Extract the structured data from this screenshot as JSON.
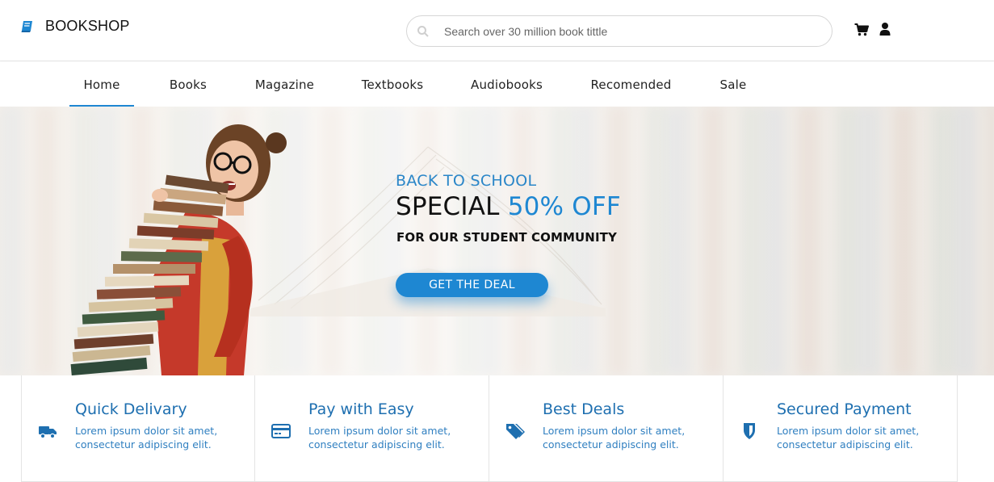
{
  "brand": {
    "name": "BOOKSHOP",
    "icon": "book-icon",
    "accent": "#1e87d2"
  },
  "search": {
    "placeholder": "Search over 30 million book tittle",
    "value": ""
  },
  "header_icons": [
    "cart-icon",
    "user-icon"
  ],
  "nav": {
    "items": [
      {
        "label": "Home",
        "active": true
      },
      {
        "label": "Books",
        "active": false
      },
      {
        "label": "Magazine",
        "active": false
      },
      {
        "label": "Textbooks",
        "active": false
      },
      {
        "label": "Audiobooks",
        "active": false
      },
      {
        "label": "Recomended",
        "active": false
      },
      {
        "label": "Sale",
        "active": false
      }
    ]
  },
  "hero": {
    "kicker": "BACK TO SCHOOL",
    "title_main": "SPECIAL ",
    "title_accent": "50% OFF",
    "subtitle": "FOR OUR STUDENT COMMUNITY",
    "cta": "GET THE DEAL"
  },
  "features": [
    {
      "title": "Quick Delivary",
      "icon": "truck-icon",
      "desc_line1": "Lorem ipsum dolor sit amet,",
      "desc_line2": "consectetur adipiscing elit."
    },
    {
      "title": "Pay with Easy",
      "icon": "credit-card-icon",
      "desc_line1": "Lorem ipsum dolor sit amet,",
      "desc_line2": "consectetur adipiscing elit."
    },
    {
      "title": "Best Deals",
      "icon": "tags-icon",
      "desc_line1": "Lorem ipsum dolor sit amet,",
      "desc_line2": "consectetur adipiscing elit."
    },
    {
      "title": "Secured Payment",
      "icon": "shield-icon",
      "desc_line1": "Lorem ipsum dolor sit amet,",
      "desc_line2": "consectetur adipiscing elit."
    }
  ]
}
